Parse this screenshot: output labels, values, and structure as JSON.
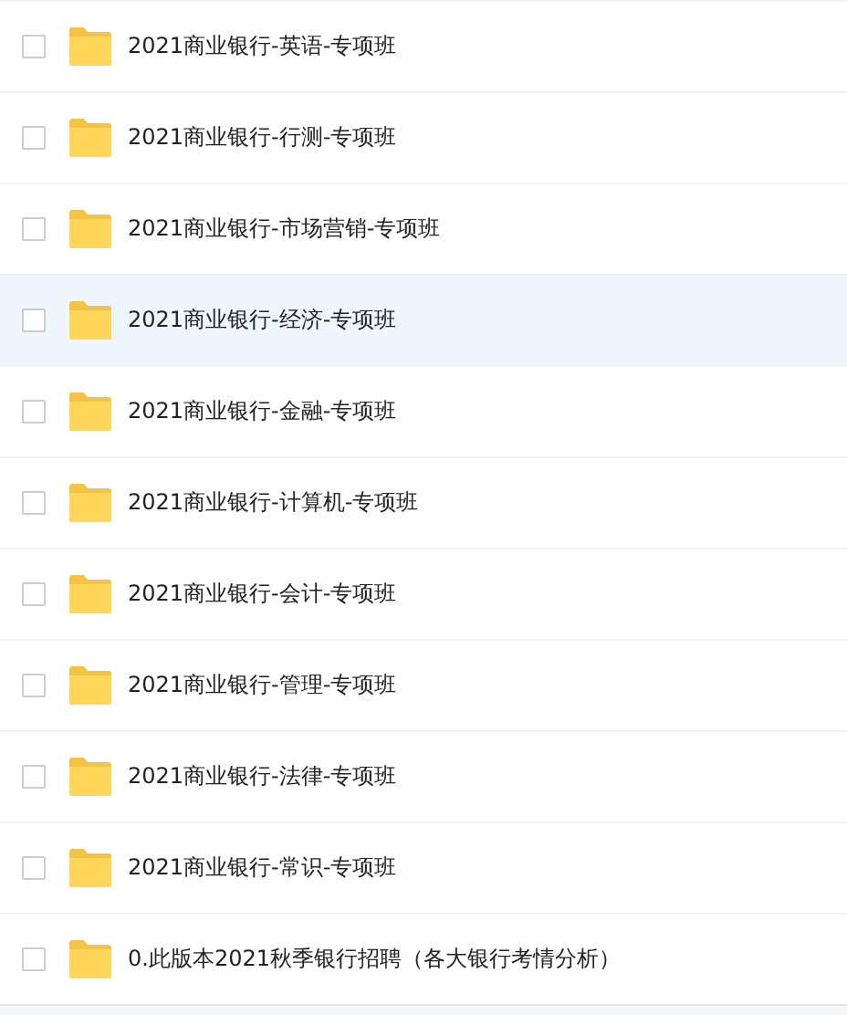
{
  "files": [
    {
      "name": "2021商业银行-英语-专项班",
      "checked": false,
      "hovered": false
    },
    {
      "name": "2021商业银行-行测-专项班",
      "checked": false,
      "hovered": false
    },
    {
      "name": "2021商业银行-市场营销-专项班",
      "checked": false,
      "hovered": false
    },
    {
      "name": "2021商业银行-经济-专项班",
      "checked": false,
      "hovered": true
    },
    {
      "name": "2021商业银行-金融-专项班",
      "checked": false,
      "hovered": false
    },
    {
      "name": "2021商业银行-计算机-专项班",
      "checked": false,
      "hovered": false
    },
    {
      "name": "2021商业银行-会计-专项班",
      "checked": false,
      "hovered": false
    },
    {
      "name": "2021商业银行-管理-专项班",
      "checked": false,
      "hovered": false
    },
    {
      "name": "2021商业银行-法律-专项班",
      "checked": false,
      "hovered": false
    },
    {
      "name": "2021商业银行-常识-专项班",
      "checked": false,
      "hovered": false
    },
    {
      "name": "0.此版本2021秋季银行招聘（各大银行考情分析）",
      "checked": false,
      "hovered": false
    }
  ]
}
